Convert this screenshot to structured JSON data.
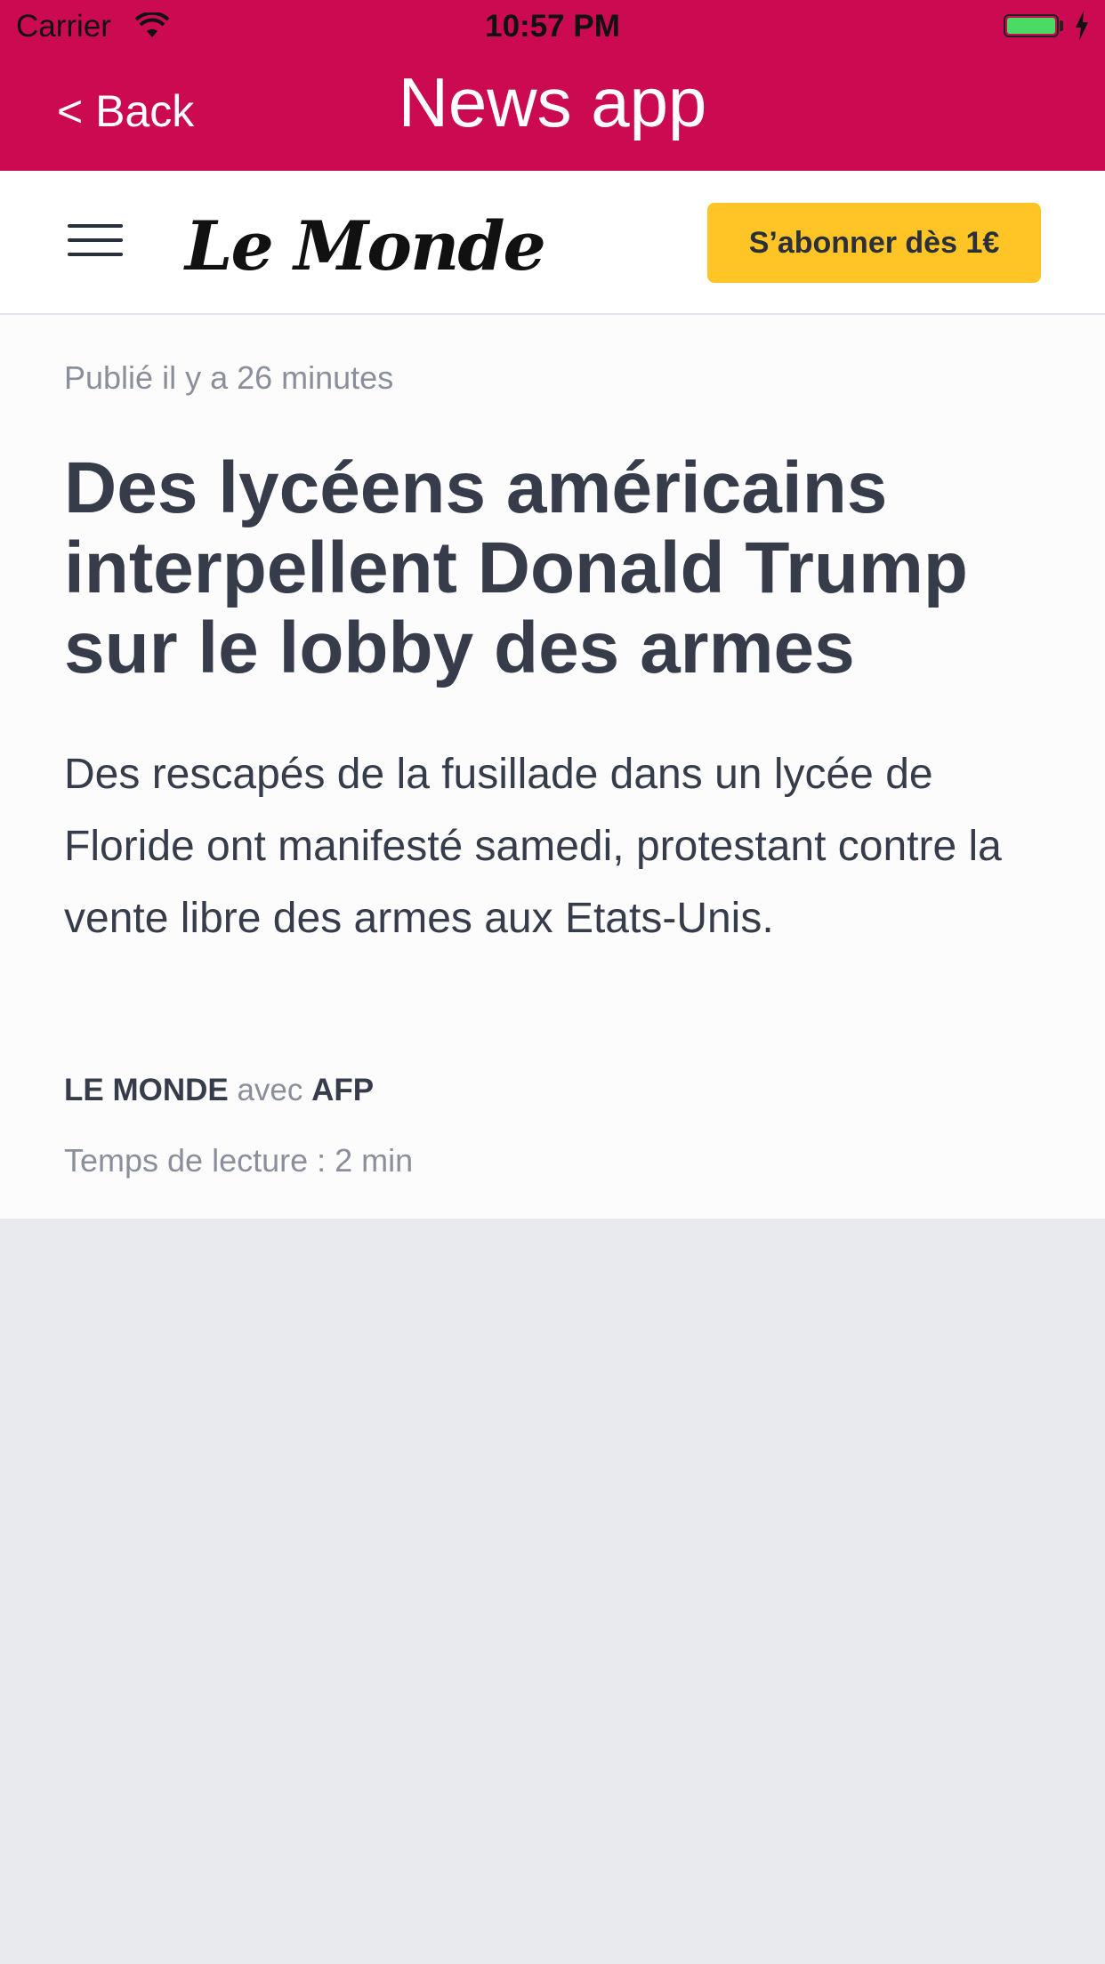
{
  "status_bar": {
    "carrier": "Carrier",
    "time": "10:57 PM",
    "battery_color": "#4cd964"
  },
  "nav": {
    "back_label": "< Back",
    "title": "News app",
    "background_color": "#cc0a51"
  },
  "header": {
    "menu_icon": "hamburger-menu-icon",
    "logo_text": "Le Monde",
    "subscribe_label": "S’abonner dès 1€",
    "subscribe_color": "#ffc527"
  },
  "article": {
    "published": "Publié il y a 26 minutes",
    "headline": "Des lycéens américains interpellent Donald Trump sur le lobby des armes",
    "lede": "Des rescapés de la fusillade dans un lycée de Floride ont manifesté samedi, protestant contre la vente libre des armes aux Etats-Unis.",
    "byline": {
      "author": "LE MONDE",
      "with": "avec",
      "agency": "AFP"
    },
    "reading_time": "Temps de lecture : 2 min"
  }
}
